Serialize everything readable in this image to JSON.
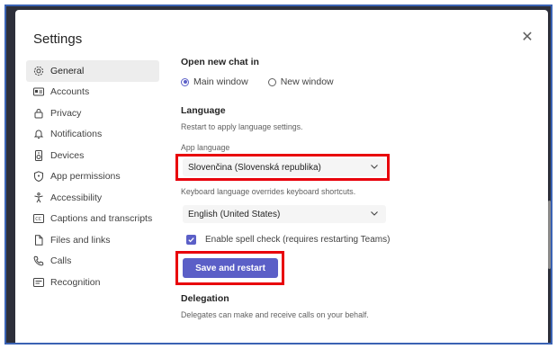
{
  "dialog": {
    "title": "Settings",
    "close_label": "✕"
  },
  "sidebar": {
    "items": [
      {
        "label": "General",
        "icon": "gear-icon",
        "active": true
      },
      {
        "label": "Accounts",
        "icon": "id-card-icon"
      },
      {
        "label": "Privacy",
        "icon": "lock-icon"
      },
      {
        "label": "Notifications",
        "icon": "bell-icon"
      },
      {
        "label": "Devices",
        "icon": "speaker-icon"
      },
      {
        "label": "App permissions",
        "icon": "shield-icon"
      },
      {
        "label": "Accessibility",
        "icon": "accessibility-icon"
      },
      {
        "label": "Captions and transcripts",
        "icon": "cc-icon"
      },
      {
        "label": "Files and links",
        "icon": "file-icon"
      },
      {
        "label": "Calls",
        "icon": "phone-icon"
      },
      {
        "label": "Recognition",
        "icon": "recognition-icon"
      }
    ]
  },
  "main": {
    "open_chat": {
      "heading": "Open new chat in",
      "options": [
        {
          "label": "Main window",
          "selected": true
        },
        {
          "label": "New window",
          "selected": false
        }
      ]
    },
    "language": {
      "heading": "Language",
      "description": "Restart to apply language settings.",
      "app_language_label": "App language",
      "app_language_value": "Slovenčina (Slovenská republika)",
      "keyboard_label": "Keyboard language overrides keyboard shortcuts.",
      "keyboard_value": "English (United States)",
      "spell_check_label": "Enable spell check (requires restarting Teams)",
      "spell_check_checked": true,
      "save_button": "Save and restart"
    },
    "delegation": {
      "heading": "Delegation",
      "description": "Delegates can make and receive calls on your behalf."
    }
  },
  "colors": {
    "accent": "#5b5fc7",
    "highlight": "#e8000b",
    "frame_border": "#3a62b3"
  }
}
